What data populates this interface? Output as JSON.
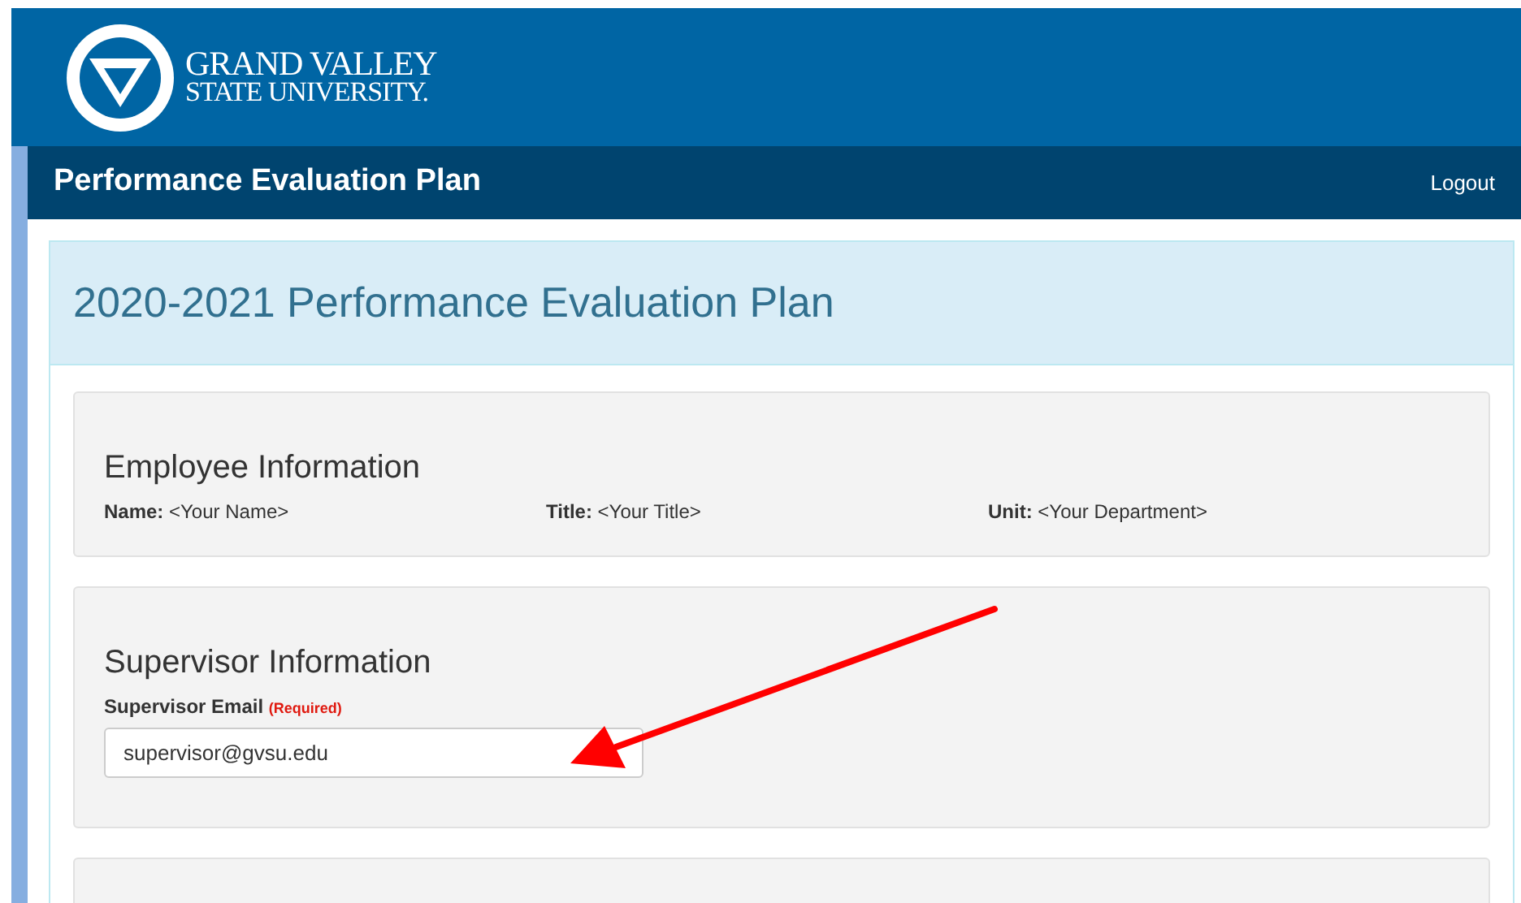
{
  "logo": {
    "line_1": "GRAND VALLEY",
    "line_2": "STATE UNIVERSITY."
  },
  "navbar": {
    "title": "Performance Evaluation Plan",
    "logout": "Logout"
  },
  "page": {
    "heading": "2020-2021 Performance Evaluation Plan"
  },
  "employee": {
    "heading": "Employee Information",
    "fields": [
      {
        "label": "Name:",
        "value": "<Your Name>"
      },
      {
        "label": "Title:",
        "value": "<Your Title>"
      },
      {
        "label": "Unit:",
        "value": "<Your Department>"
      }
    ]
  },
  "supervisor": {
    "heading": "Supervisor Information",
    "email_label": "Supervisor Email",
    "required": "(Required)",
    "email_value": "supervisor@gvsu.edu"
  }
}
